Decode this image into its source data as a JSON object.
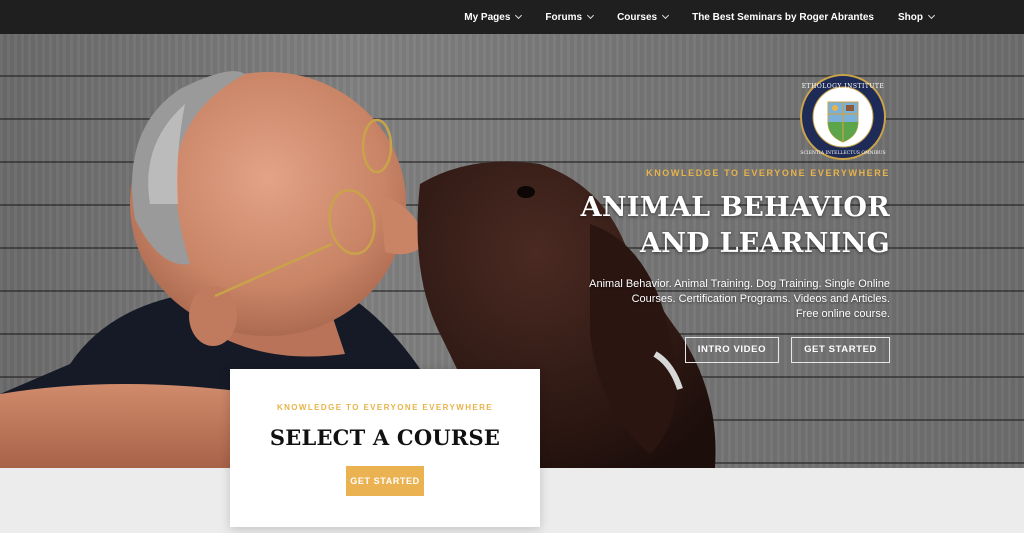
{
  "nav": {
    "items": [
      {
        "label": "My Pages",
        "has_dropdown": true
      },
      {
        "label": "Forums",
        "has_dropdown": true
      },
      {
        "label": "Courses",
        "has_dropdown": true
      },
      {
        "label": "The Best Seminars by Roger Abrantes",
        "has_dropdown": false
      },
      {
        "label": "Shop",
        "has_dropdown": true
      }
    ]
  },
  "hero": {
    "eyebrow": "Knowledge to Everyone Everywhere",
    "headline_line1": "ANIMAL BEHAVIOR",
    "headline_line2": "AND LEARNING",
    "subtext_line1": "Animal Behavior. Animal Training. Dog Training. Single Online",
    "subtext_line2": "Courses. Certification Programs. Videos and Articles.",
    "subtext_line3": "Free online course.",
    "buttons": {
      "intro_video": "INTRO VIDEO",
      "get_started": "GET STARTED"
    },
    "logo": {
      "ring_text_top": "ETHOLOGY INSTITUTE",
      "ring_text_bottom": "SCIENTIA INTELLECTUS OMNIBUS"
    }
  },
  "card": {
    "eyebrow": "KNOWLEDGE TO EVERYONE EVERYWHERE",
    "title": "SELECT A COURSE",
    "button": "GET STARTED"
  },
  "colors": {
    "nav_bg": "#1f1f1f",
    "accent_gold": "#ebb251",
    "hero_wood": "#777777"
  }
}
